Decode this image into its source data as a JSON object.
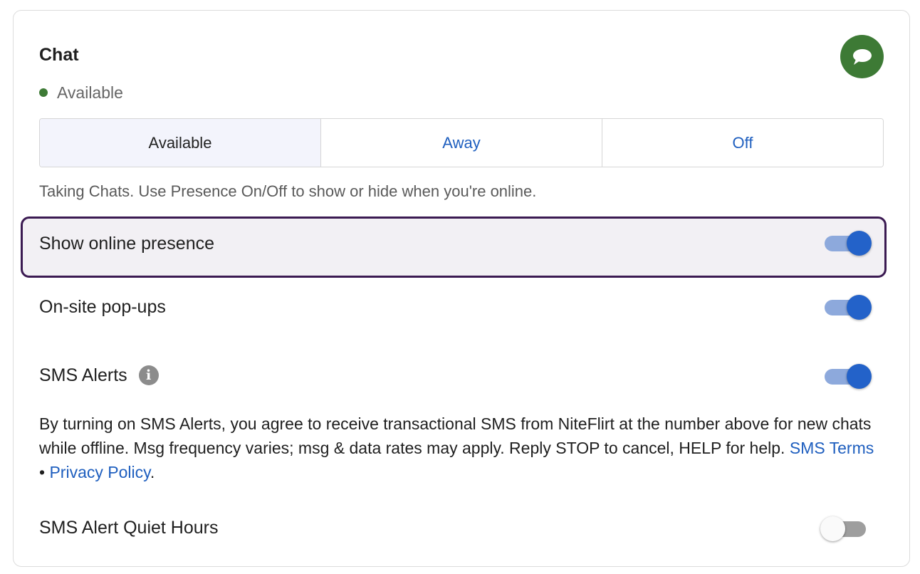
{
  "header": {
    "title": "Chat",
    "icon": "chat-bubble-icon",
    "brand_color": "#3d7a35"
  },
  "status": {
    "label": "Available",
    "dot_color": "#3d7a35"
  },
  "segments": [
    {
      "label": "Available",
      "selected": true
    },
    {
      "label": "Away",
      "selected": false
    },
    {
      "label": "Off",
      "selected": false
    }
  ],
  "helper_text": "Taking Chats. Use Presence On/Off to show or hide when you're online.",
  "settings": {
    "show_online_presence": {
      "label": "Show online presence",
      "on": true
    },
    "onsite_popups": {
      "label": "On-site pop-ups",
      "on": true
    },
    "sms_alerts": {
      "label": "SMS Alerts",
      "on": true,
      "icon": "info-icon"
    },
    "sms_quiet_hours": {
      "label": "SMS Alert Quiet Hours",
      "on": false
    }
  },
  "disclaimer": {
    "text": "By turning on SMS Alerts, you agree to receive transactional SMS from NiteFlirt at the number above for new chats while offline. Msg frequency varies; msg & data rates may apply. Reply STOP to cancel, HELP for help.",
    "sms_terms_link": "SMS Terms",
    "separator": "•",
    "privacy_link": "Privacy Policy",
    "end": "."
  },
  "colors": {
    "link": "#1f5fbf",
    "toggle_on_knob": "#2362c9",
    "toggle_on_track": "#8da9dc",
    "toggle_off_track": "#9e9e9e",
    "highlight_border": "#3b1a52"
  }
}
